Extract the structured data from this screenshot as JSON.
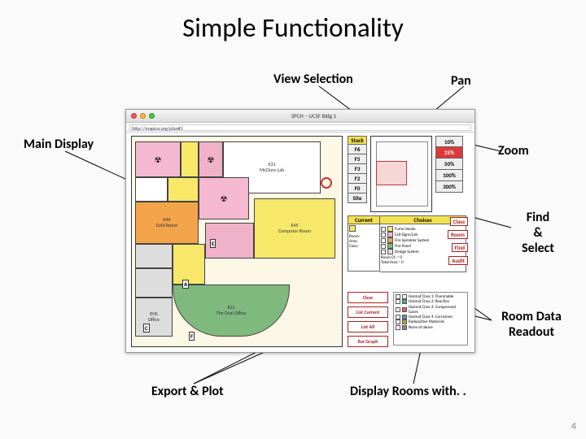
{
  "title": "Simple Functionality",
  "page_number": "4",
  "annotations": {
    "view_selection": "View Selection",
    "pan": "Pan",
    "main_display": "Main Display",
    "zoom": "Zoom",
    "find_select": "Find\n&\nSelect",
    "room_data": "Room Data\nReadout",
    "export_plot": "Export & Plot",
    "display_rooms": "Display Rooms with. ."
  },
  "shot": {
    "window_title": "SPCH – UCSF Bldg 1",
    "url": "http://mapico.org/plan#1",
    "stack": {
      "header": "Stack",
      "items": [
        "F6",
        "F5",
        "F3",
        "F2",
        "F0",
        "Site"
      ]
    },
    "zoom": [
      "10%",
      "25%",
      "50%",
      "100%",
      "300%"
    ],
    "rooms": {
      "mcclure": "631\nMcClure Lab",
      "cold": "644\nCold Room",
      "computer": "645\nComputer Room",
      "oval": "631\nThe Oval Office",
      "ehs": "EHS\nOffice"
    },
    "markers": [
      "E",
      "A",
      "C",
      "F"
    ],
    "readout": {
      "current_hdr": "Current",
      "choices_hdr": "Choices",
      "cur_room": "Room:",
      "cur_area": "Area:",
      "cur_class": "Class:",
      "choices": [
        "Fume Hoods",
        "Exit Signs/Lab",
        "Fire Sprinkler System",
        "Fire Panel",
        "Deluge System"
      ],
      "room_ct": "Room Ct: = 0",
      "total_area": "Total Area = 0"
    },
    "find": {
      "class": "Class",
      "room": "Room",
      "find": "Find",
      "audit": "Audit"
    },
    "export": [
      "Clear",
      "List Current",
      "List All",
      "Bar Graph"
    ],
    "disp": [
      "Hazmat Class 1: Flammable",
      "Hazmat Class 2: Reactive",
      "Hazmat Class 3: Compressed Gases",
      "Hazmat Class 4: Corrosives",
      "Radioactive Materials",
      "None of above"
    ]
  }
}
